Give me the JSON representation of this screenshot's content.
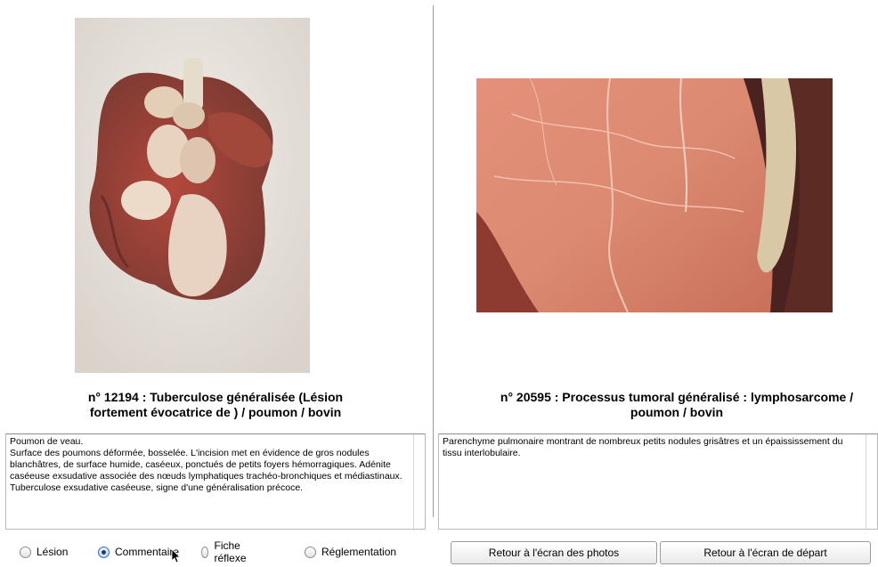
{
  "left": {
    "caption_line1": "n° 12194 : Tuberculose généralisée (Lésion",
    "caption_line2": "fortement évocatrice de ) / poumon / bovin",
    "comment_lines": [
      "Poumon de veau.",
      "Surface des poumons déformée, bosselée. L'incision met en évidence de gros nodules",
      "blanchâtres, de surface humide, caséeux, ponctués de petits foyers hémorragiques. Adénite",
      "caséeuse exsudative associée des nœuds lymphatiques trachéo-bronchiques et médiastinaux.",
      "Tuberculose exsudative caséeuse, signe d'une généralisation précoce."
    ]
  },
  "right": {
    "caption_line1": "n° 20595 : Processus tumoral généralisé : lymphosarcome /",
    "caption_line2": "poumon / bovin",
    "comment_lines": [
      "Parenchyme pulmonaire montrant de nombreux petits nodules grisâtres et un épaississement du",
      "tissu interlobulaire."
    ]
  },
  "radios": [
    {
      "label": "Lésion",
      "selected": false
    },
    {
      "label": "Commentaire",
      "selected": true
    },
    {
      "label": "Fiche réflexe",
      "selected": false
    },
    {
      "label": "Réglementation",
      "selected": false
    }
  ],
  "buttons": {
    "photos": "Retour à l'écran des photos",
    "depart": "Retour à l'écran de départ"
  }
}
